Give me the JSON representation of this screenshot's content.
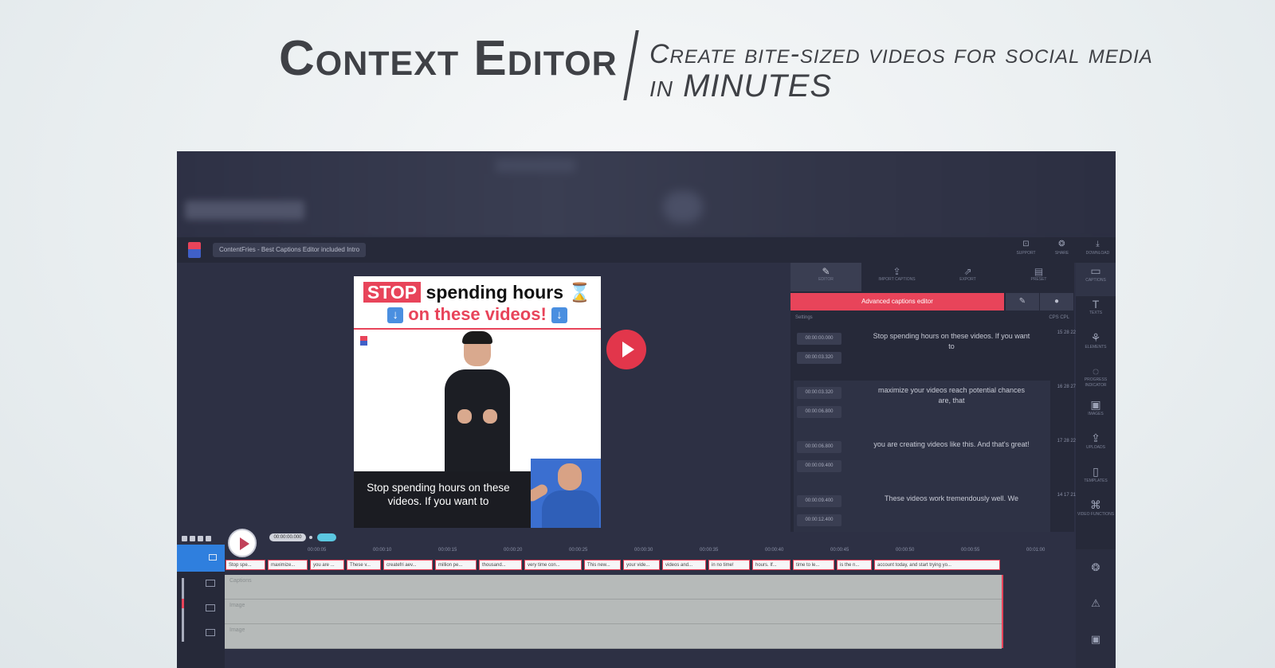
{
  "header": {
    "brand": "Context Editor",
    "tagline_line1": "Create bite-sized videos for social media",
    "tagline_line2": "in MINUTES"
  },
  "app": {
    "project_title": "ContentFries - Best Captions Editor included Intro",
    "top_actions": [
      {
        "icon": "support-icon",
        "label": "SUPPORT"
      },
      {
        "icon": "share-icon",
        "label": "SHARE"
      },
      {
        "icon": "download-icon",
        "label": "DOWNLOAD"
      }
    ]
  },
  "video": {
    "headline_stop": "STOP",
    "headline_rest": "spending hours",
    "headline_line2": "on these videos!",
    "caption": "Stop spending hours on these videos. If you want to"
  },
  "panel": {
    "tabs": [
      {
        "label": "EDITOR",
        "icon": "pencil-icon"
      },
      {
        "label": "IMPORT CAPTIONS",
        "icon": "upload-icon"
      },
      {
        "label": "EXPORT",
        "icon": "export-icon"
      },
      {
        "label": "PRESET",
        "icon": "preset-icon"
      }
    ],
    "advanced_button": "Advanced captions editor",
    "settings_label": "Settings",
    "cps_label": "CPS CPL",
    "entries": [
      {
        "start": "00:00:00.000",
        "end": "00:00:03.320",
        "text": "Stop spending hours on these videos. If you want to",
        "nums": "15  28 22"
      },
      {
        "start": "00:00:03.320",
        "end": "00:00:06.800",
        "text": "maximize your videos reach potential chances are, that",
        "nums": "16  28 27"
      },
      {
        "start": "00:00:06.800",
        "end": "00:00:09.400",
        "text": "you are creating videos like this. And that's great!",
        "nums": "17  28 22"
      },
      {
        "start": "00:00:09.400",
        "end": "00:00:12.400",
        "text": "These videos work tremendously well. We",
        "nums": "14  17 21"
      }
    ]
  },
  "tools": [
    {
      "icon": "captions-icon",
      "label": "CAPTIONS"
    },
    {
      "icon": "text-icon",
      "label": "TEXTS"
    },
    {
      "icon": "elements-icon",
      "label": "ELEMENTS"
    },
    {
      "icon": "progress-icon",
      "label": "PROGRESS INDICATOR"
    },
    {
      "icon": "image-icon",
      "label": "IMAGES"
    },
    {
      "icon": "upload-icon",
      "label": "UPLOADS"
    },
    {
      "icon": "template-icon",
      "label": "TEMPLATES"
    },
    {
      "icon": "video-icon",
      "label": "VIDEO FUNCTIONS"
    }
  ],
  "timeline": {
    "time_display": "00:00:00.000",
    "ticks": [
      "00:00:05",
      "00:00:10",
      "00:00:15",
      "00:00:20",
      "00:00:25",
      "00:00:30",
      "00:00:35",
      "00:00:40",
      "00:00:45",
      "00:00:50",
      "00:00:55",
      "00:01:00"
    ],
    "clips": [
      "Stop spe...",
      "maximize...",
      "you are ...",
      "These v...",
      "createfri aev...",
      "million pe...",
      "thousand...",
      "very time con...",
      "This new...",
      "your vide...",
      "videos and...",
      "in no time!",
      "hours. If...",
      "time to le...",
      "is the n...",
      "account today, and start trying yo..."
    ],
    "tracks": [
      "Captions",
      "Image",
      "Image"
    ]
  },
  "colors": {
    "accent": "#e8445a",
    "app_bg": "#2d3044",
    "highlight_blue": "#2f7fde"
  }
}
